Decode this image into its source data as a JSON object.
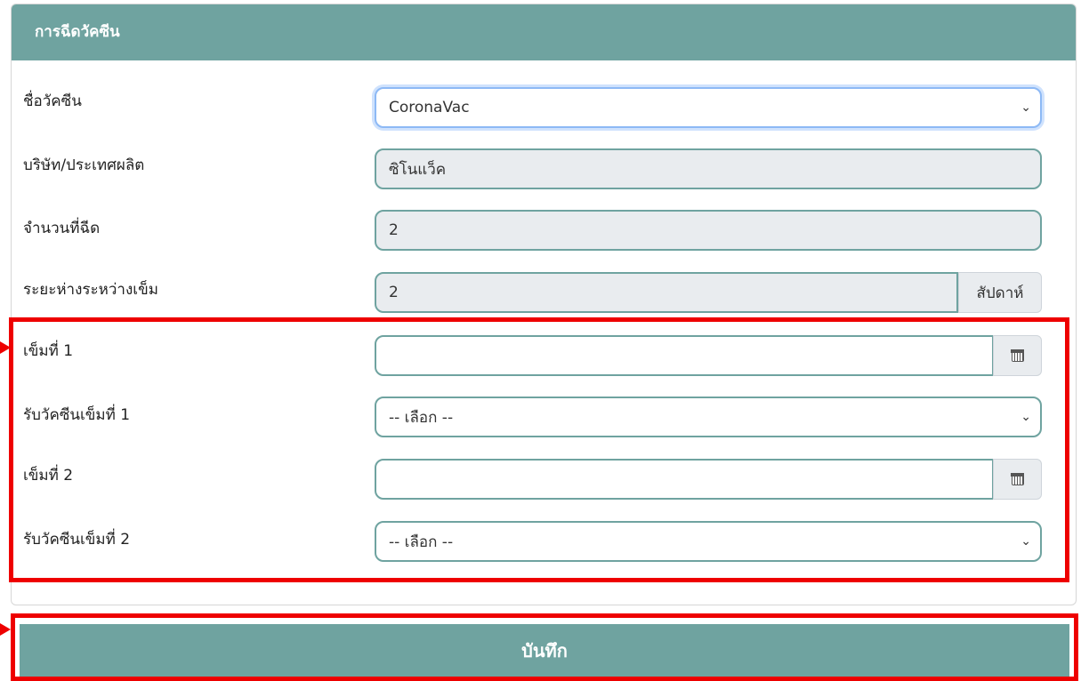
{
  "card": {
    "title": "การฉีดวัคซีน"
  },
  "form": {
    "vaccine_name": {
      "label": "ชื่อวัคซีน",
      "value": "CoronaVac"
    },
    "manufacturer": {
      "label": "บริษัท/ประเทศผลิต",
      "value": "ซิโนแว็ค"
    },
    "doses": {
      "label": "จำนวนที่ฉีด",
      "value": "2"
    },
    "interval": {
      "label": "ระยะห่างระหว่างเข็ม",
      "value": "2",
      "unit": "สัปดาห์"
    },
    "dose1_date": {
      "label": "เข็มที่ 1",
      "value": ""
    },
    "dose1_received": {
      "label": "รับวัคซีนเข็มที่ 1",
      "value": "-- เลือก --"
    },
    "dose2_date": {
      "label": "เข็มที่ 2",
      "value": ""
    },
    "dose2_received": {
      "label": "รับวัคซีนเข็มที่ 2",
      "value": "-- เลือก --"
    }
  },
  "actions": {
    "save_label": "บันทึก"
  },
  "colors": {
    "header": "#6fa3a0",
    "annotation": "#ee0000",
    "focus": "#8db9f5"
  },
  "icons": {
    "select": "chevron-down-icon",
    "date": "calendar-icon"
  }
}
